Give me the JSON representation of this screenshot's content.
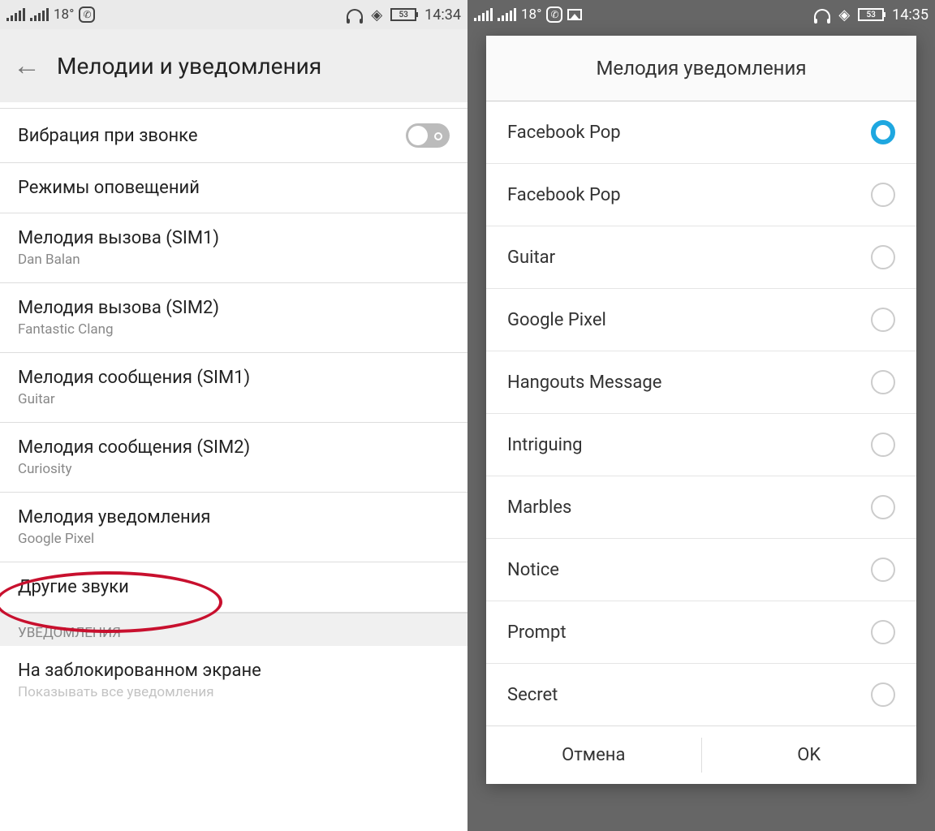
{
  "left": {
    "status": {
      "temp": "18°",
      "battery": "53",
      "time": "14:34"
    },
    "title": "Мелодии и уведомления",
    "rows": {
      "vibrate": "Вибрация при звонке",
      "modes": "Режимы оповещений",
      "sim1call": {
        "lbl": "Мелодия вызова (SIM1)",
        "sub": "Dan Balan"
      },
      "sim2call": {
        "lbl": "Мелодия вызова (SIM2)",
        "sub": "Fantastic Clang"
      },
      "sim1msg": {
        "lbl": "Мелодия сообщения (SIM1)",
        "sub": "Guitar"
      },
      "sim2msg": {
        "lbl": "Мелодия сообщения (SIM2)",
        "sub": "Curiosity"
      },
      "notif": {
        "lbl": "Мелодия уведомления",
        "sub": "Google Pixel"
      },
      "other": "Другие звуки",
      "section": "УВЕДОМЛЕНИЯ",
      "lock": {
        "lbl": "На заблокированном экране",
        "sub": "Показывать все уведомления"
      }
    }
  },
  "right": {
    "status": {
      "temp": "18°",
      "battery": "53",
      "time": "14:35"
    },
    "dialog": {
      "title": "Мелодия уведомления",
      "options": [
        "Facebook Pop",
        "Facebook Pop",
        "Guitar",
        "Google Pixel",
        "Hangouts Message",
        "Intriguing",
        "Marbles",
        "Notice",
        "Prompt",
        "Secret"
      ],
      "selectedIndex": 0,
      "cancel": "Отмена",
      "ok": "OK"
    }
  }
}
